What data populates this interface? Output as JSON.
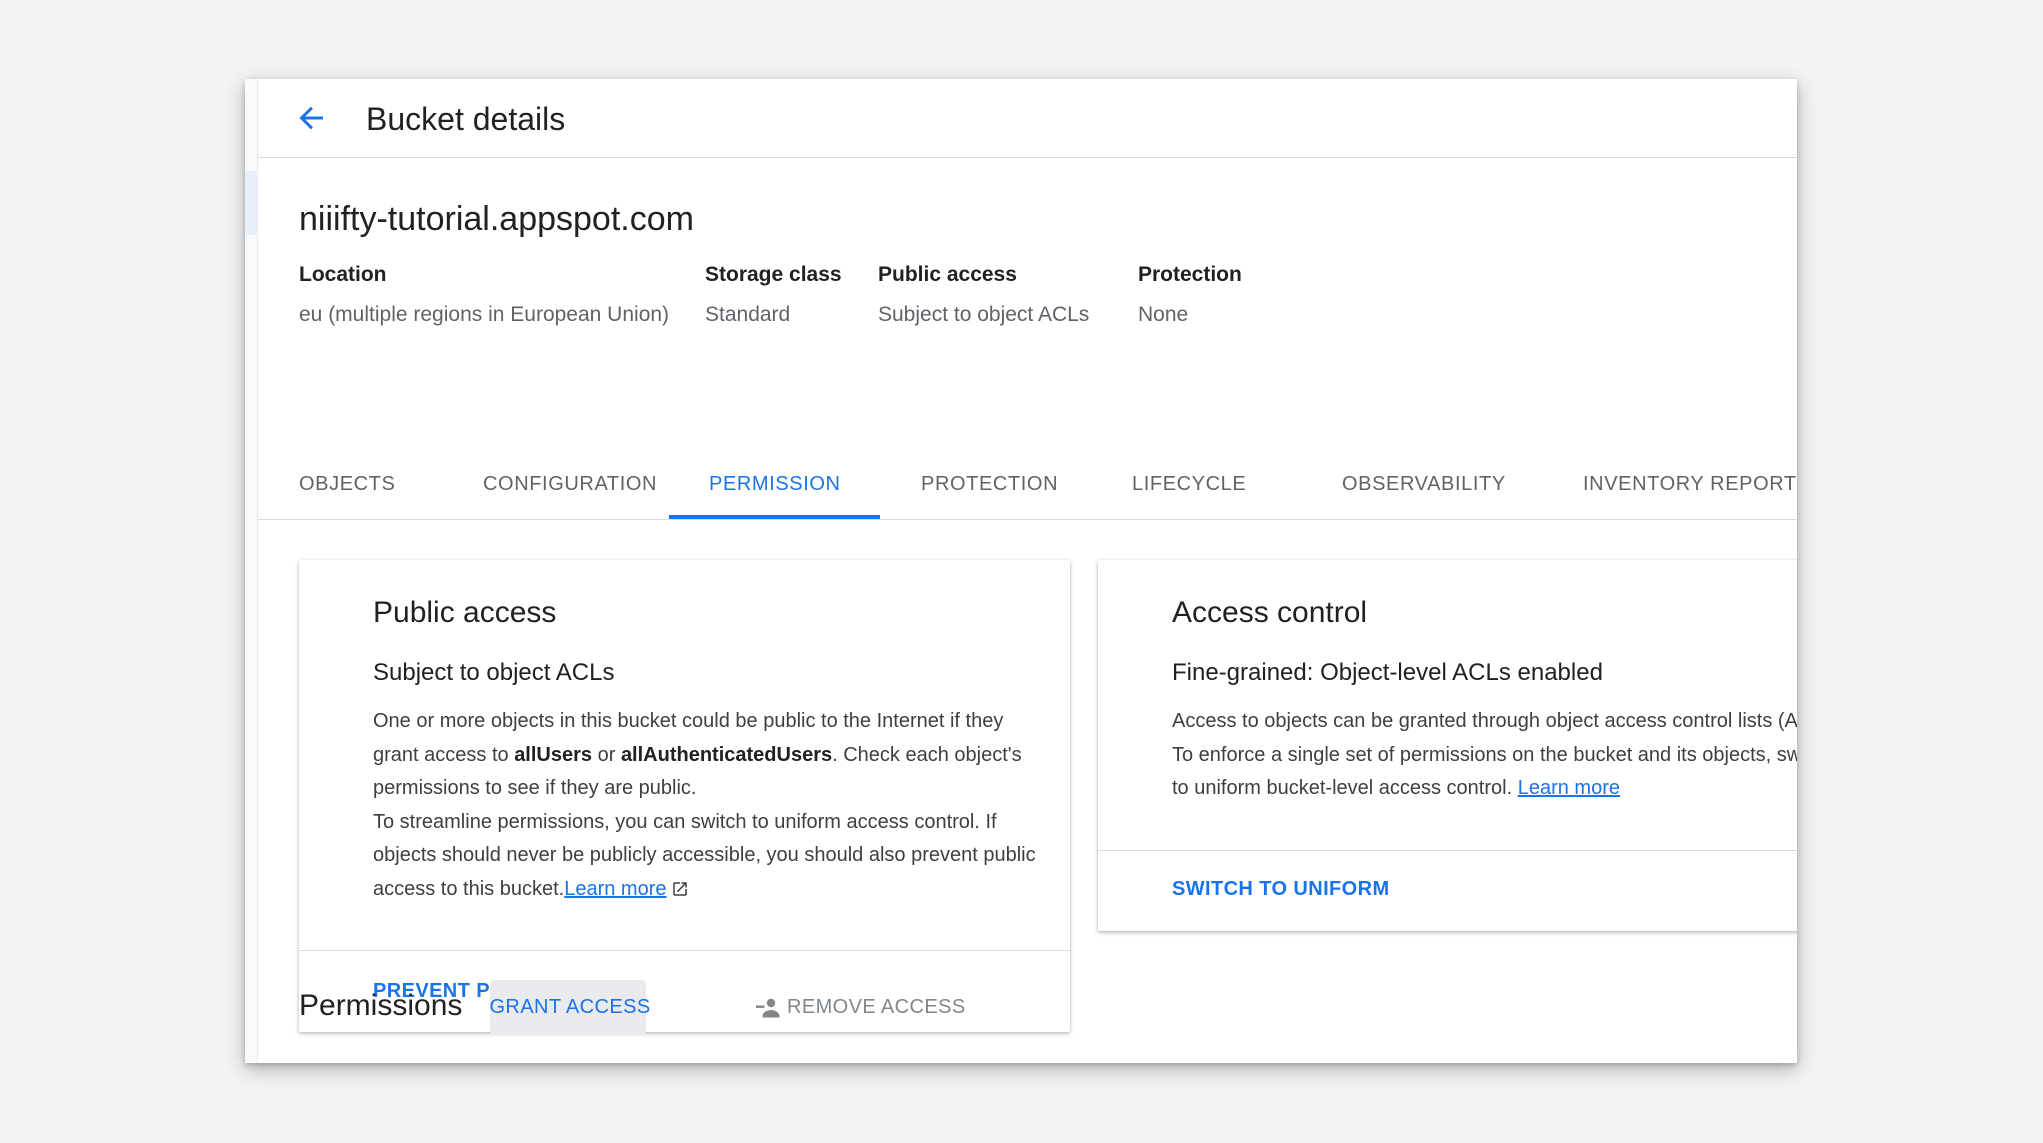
{
  "header": {
    "title": "Bucket details"
  },
  "bucket": {
    "name": "niiifty-tutorial.appspot.com",
    "meta": {
      "location_label": "Location",
      "location_value": "eu (multiple regions in European Union)",
      "storage_label": "Storage class",
      "storage_value": "Standard",
      "public_label": "Public access",
      "public_value": "Subject to object ACLs",
      "protection_label": "Protection",
      "protection_value": "None"
    }
  },
  "tabs": {
    "objects": "OBJECTS",
    "configuration": "CONFIGURATION",
    "permission": "PERMISSION",
    "protection": "PROTECTION",
    "lifecycle": "LIFECYCLE",
    "observability": "OBSERVABILITY",
    "inventory": "INVENTORY REPORTS",
    "active": "PERMISSION"
  },
  "public_card": {
    "title": "Public access",
    "subtitle": "Subject to object ACLs",
    "p1_a": "One or more objects in this bucket could be public to the Internet if they grant access to ",
    "p1_b": "allUsers",
    "p1_c": " or ",
    "p1_d": "allAuthenticatedUsers",
    "p1_e": ". Check each object's permissions to see if they are public.",
    "p2": "To streamline permissions, you can switch to uniform access control. If objects should never be publicly accessible, you should also prevent public access to this bucket.",
    "learn_more": "Learn more",
    "action": "PREVENT PUBLIC ACCESS"
  },
  "access_card": {
    "title": "Access control",
    "subtitle": "Fine-grained: Object-level ACLs enabled",
    "body": "Access to objects can be granted through object access control lists (ACLs). To enforce a single set of permissions on the bucket and its objects, switch to uniform bucket-level access control. ",
    "learn_more": "Learn more",
    "action": "SWITCH TO UNIFORM"
  },
  "permissions": {
    "title": "Permissions",
    "grant": "GRANT ACCESS",
    "remove": "REMOVE ACCESS"
  },
  "colors": {
    "accent": "#1a73e8",
    "text": "#202124",
    "muted": "#5f6368",
    "divider": "#dadce0",
    "background": "#f1f3f4"
  },
  "icons": [
    "arrow-back-icon",
    "open-in-new-icon",
    "person-add-icon",
    "person-remove-icon"
  ]
}
